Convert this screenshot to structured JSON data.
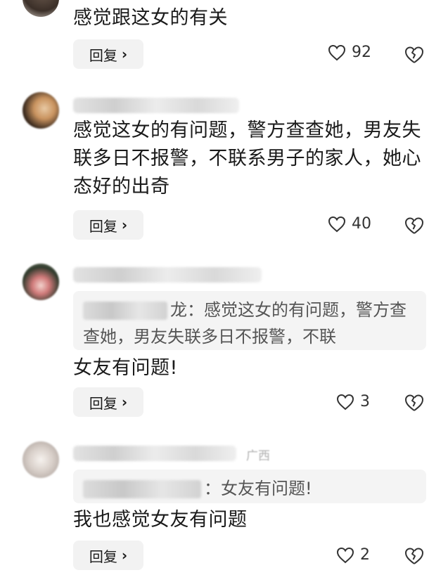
{
  "comments": [
    {
      "text": "感觉跟这女的有关",
      "reply_label": "回复",
      "likes": "92"
    },
    {
      "meta_tail": "",
      "text": "感觉这女的有问题，警方查查她，男友失联多日不报警，不联系男子的家人，她心态好的出奇",
      "reply_label": "回复",
      "likes": "40"
    },
    {
      "quote_text": "龙：感觉这女的有问题，警方查查她，男友失联多日不报警，不联",
      "text": "女友有问题!",
      "reply_label": "回复",
      "likes": "3"
    },
    {
      "meta_tail": "广西",
      "quote_text": "：女友有问题!",
      "text": "我也感觉女友有问题",
      "reply_label": "回复",
      "likes": "2"
    }
  ],
  "icons": {
    "like": "heart-outline-icon",
    "dislike": "broken-heart-icon",
    "chevron": "chevron-right-icon"
  }
}
